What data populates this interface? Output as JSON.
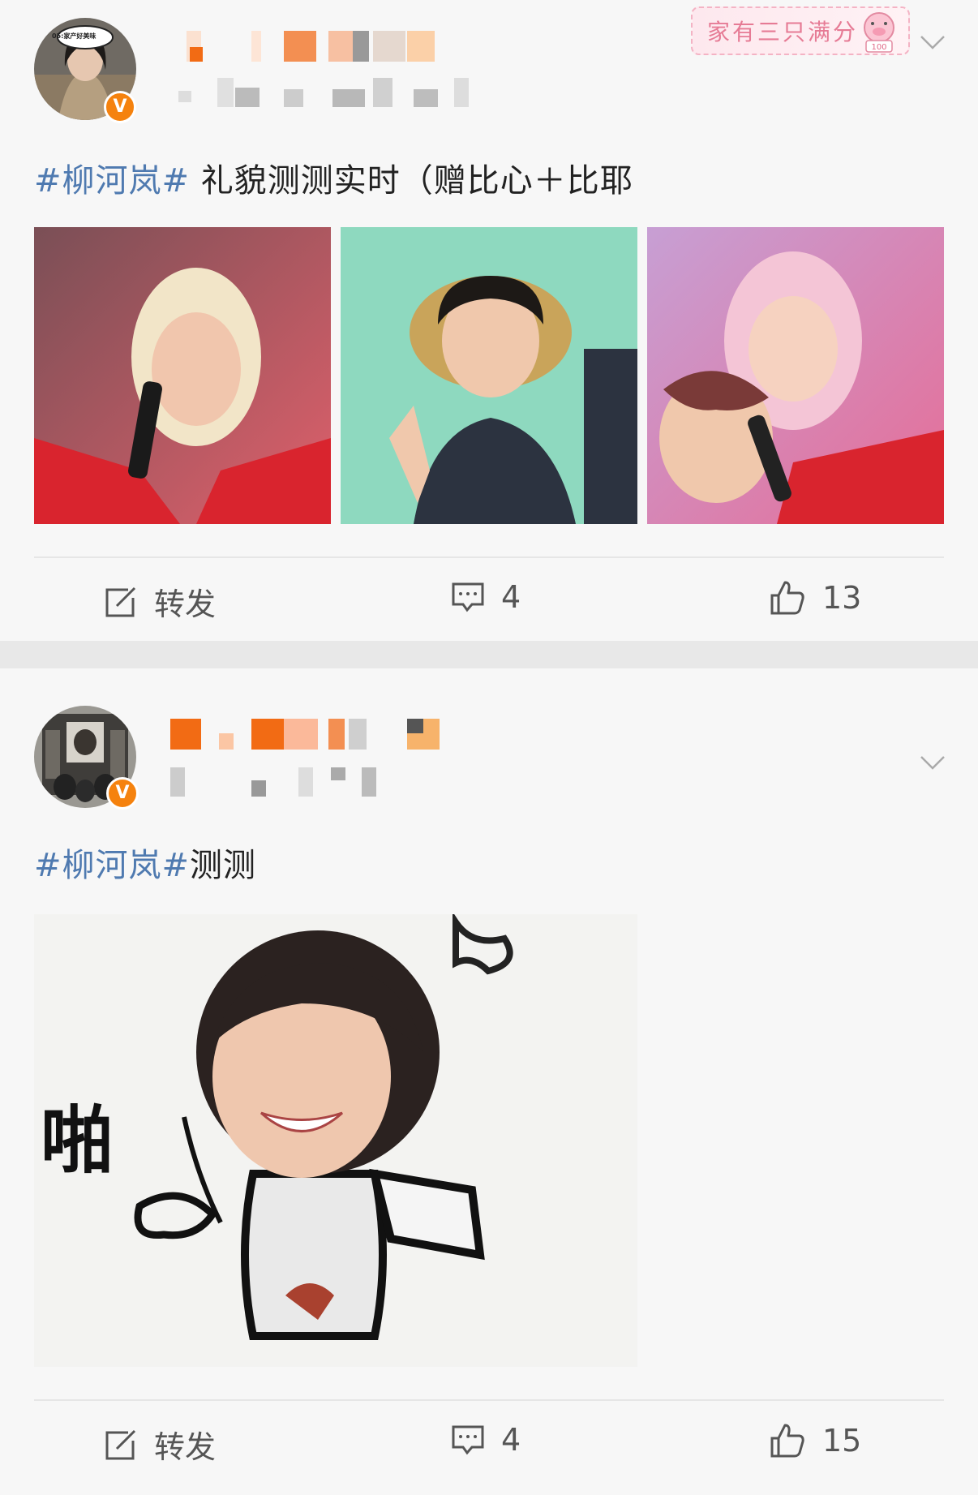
{
  "feed": {
    "posts": [
      {
        "badge": {
          "text": "家有三只满分",
          "score": "100"
        },
        "avatar_caption": "05:家产好美味",
        "hashtag": "#柳河岚#",
        "text": " 礼貌测测实时（赠比心＋比耶",
        "images": [
          "photo-pink-heart",
          "photo-straw-hat-peace",
          "photo-pink-duo"
        ],
        "actions": {
          "repost_label": "转发",
          "comments": "4",
          "likes": "13"
        }
      },
      {
        "hashtag": "#柳河岚#",
        "text": "测测",
        "sticker_text": "啪",
        "actions": {
          "repost_label": "转发",
          "comments": "4",
          "likes": "15"
        }
      }
    ]
  },
  "colors": {
    "hashtag": "#4f7ab0",
    "verified": "#f5820e",
    "background": "#f7f7f7",
    "separator": "#e8e8e8"
  }
}
